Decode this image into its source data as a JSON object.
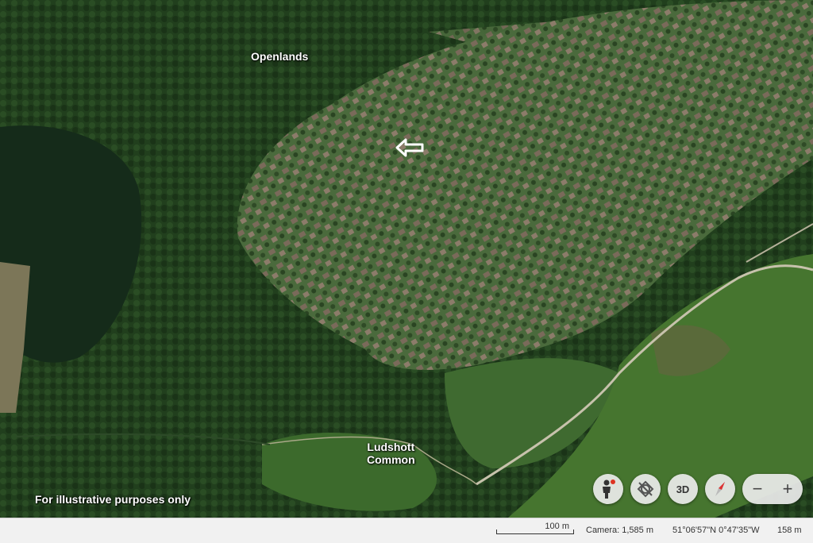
{
  "map": {
    "labels": {
      "openlands": "Openlands",
      "ludshott": "Ludshott\nCommon",
      "disclaimer": "For illustrative purposes only"
    },
    "pointer_icon": "left-arrow-icon",
    "colors": {
      "forest": "#1f3d1c",
      "dark_forest": "#142b18",
      "residential": "#4e6a3e",
      "heath": "#4f7a36",
      "path": "#c7c2ac"
    }
  },
  "controls": {
    "pegman_icon": "pegman-icon",
    "rotate_icon": "rotate-icon",
    "three_d_label": "3D",
    "compass_icon": "compass-icon",
    "zoom_out_label": "−",
    "zoom_in_label": "+"
  },
  "status": {
    "scale_label": "100 m",
    "camera": "Camera: 1,585 m",
    "coordinates": "51°06'57\"N 0°47'35\"W",
    "elevation": "158 m"
  }
}
